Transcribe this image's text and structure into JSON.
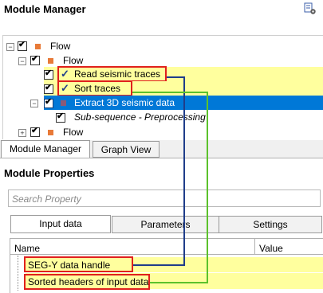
{
  "manager": {
    "title": "Module Manager",
    "tree": {
      "root": "Flow",
      "child": "Flow",
      "items": [
        "Read seismic traces",
        "Sort traces",
        "Extract 3D seismic data"
      ],
      "subsequence": "Sub-sequence - Preprocessing",
      "bottom": "Flow"
    }
  },
  "tabs": [
    "Module Manager",
    "Graph View"
  ],
  "properties": {
    "title": "Module Properties",
    "search_placeholder": "Search Property",
    "subtabs": [
      "Input data",
      "Parameters",
      "Settings"
    ],
    "columns": [
      "Name",
      "Value"
    ],
    "rows": [
      "SEG-Y data handle",
      "Sorted headers of input data"
    ]
  },
  "colors": {
    "selection": "#0078d7",
    "highlight_row": "#ffff9e",
    "annotation_red": "#e0201d",
    "connector_blue": "#1f3d8a",
    "connector_green": "#5cc22c",
    "node_square": "#e87a38"
  },
  "icons": [
    "settings-icon",
    "checkbox-icon",
    "expand-icon",
    "flow-node-icon"
  ]
}
